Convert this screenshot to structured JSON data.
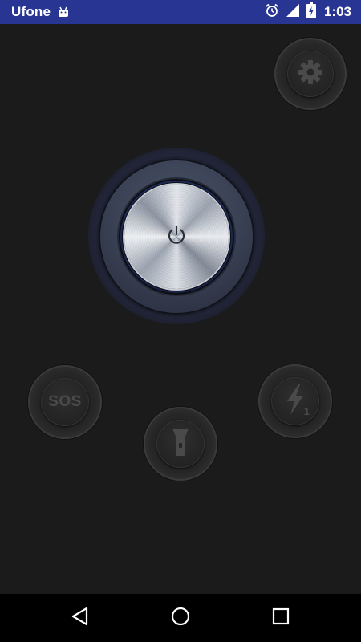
{
  "status_bar": {
    "carrier": "Ufone",
    "time": "1:03",
    "battery_level": 0.85,
    "icons": [
      "android-notification-icon",
      "alarm-icon",
      "signal-icon",
      "battery-charging-icon"
    ],
    "background_color": "#283593"
  },
  "main": {
    "power_button": {
      "icon": "power-icon",
      "state": "off"
    },
    "settings_button": {
      "icon": "gear-icon"
    },
    "sos_button": {
      "label": "SOS"
    },
    "flash_mode_button": {
      "icon": "lightning-icon",
      "number": "1"
    },
    "torch_button": {
      "icon": "flashlight-icon"
    }
  },
  "nav_bar": {
    "icons": [
      "back-icon",
      "home-icon",
      "recents-icon"
    ]
  }
}
